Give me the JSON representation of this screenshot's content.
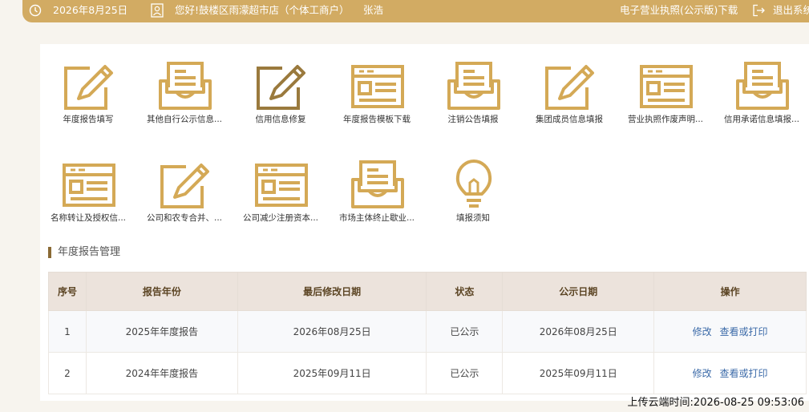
{
  "header": {
    "date": "2026年8月25日",
    "company": "您好!鼓楼区雨濛超市店（个体工商户）",
    "user": "张浩",
    "license_link": "电子营业执照(公示版)下载",
    "logout": "退出系统"
  },
  "tiles": [
    {
      "label": "年度报告填写",
      "icon": "edit-icon"
    },
    {
      "label": "其他自行公示信息...",
      "icon": "tray-doc-icon"
    },
    {
      "label": "信用信息修复",
      "icon": "edit-icon"
    },
    {
      "label": "年度报告模板下载",
      "icon": "form-doc-icon"
    },
    {
      "label": "注销公告填报",
      "icon": "tray-doc-icon"
    },
    {
      "label": "集团成员信息填报",
      "icon": "edit-icon"
    },
    {
      "label": "营业执照作废声明...",
      "icon": "form-doc-icon"
    },
    {
      "label": "信用承诺信息填报...",
      "icon": "tray-doc-icon"
    },
    {
      "label": "名称转让及授权信...",
      "icon": "form-doc-icon"
    },
    {
      "label": "公司和农专合并、...",
      "icon": "edit-icon"
    },
    {
      "label": "公司减少注册资本...",
      "icon": "form-doc-icon"
    },
    {
      "label": "市场主体终止歇业...",
      "icon": "tray-doc-icon"
    },
    {
      "label": "填报须知",
      "icon": "lightbulb-icon"
    }
  ],
  "section": {
    "title": "年度报告管理"
  },
  "table": {
    "headers": [
      "序号",
      "报告年份",
      "最后修改日期",
      "状态",
      "公示日期",
      "操作"
    ],
    "rows": [
      {
        "no": "1",
        "year": "2025年年度报告",
        "modified": "2026年08月25日",
        "status": "已公示",
        "public_date": "2026年08月25日"
      },
      {
        "no": "2",
        "year": "2024年年度报告",
        "modified": "2025年09月11日",
        "status": "已公示",
        "public_date": "2025年09月11日"
      }
    ],
    "actions": {
      "edit": "修改",
      "view": "查看或打印"
    }
  },
  "footer": {
    "upload_time": "上传云端时间:2026-08-25 09:53:06"
  },
  "colors": {
    "gold": "#d2ab63",
    "icon_gold": "#d4a956",
    "icon_brown": "#9a7a3d",
    "header_bg": "#ece3dc",
    "link": "#3b6aa8"
  }
}
